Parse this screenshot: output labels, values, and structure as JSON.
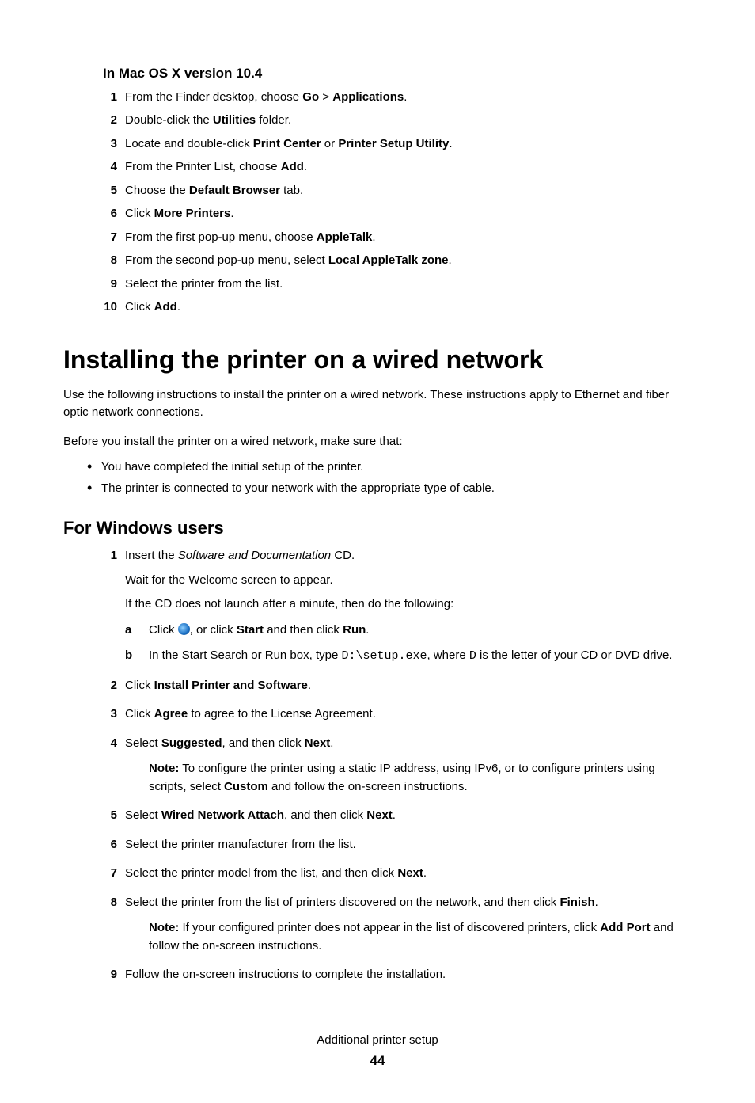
{
  "section_mac": {
    "heading": "In Mac OS X version 10.4",
    "steps": [
      {
        "n": "1",
        "parts": [
          "From the Finder desktop, choose ",
          {
            "b": "Go"
          },
          " > ",
          {
            "b": "Applications"
          },
          "."
        ]
      },
      {
        "n": "2",
        "parts": [
          "Double-click the ",
          {
            "b": "Utilities"
          },
          " folder."
        ]
      },
      {
        "n": "3",
        "parts": [
          "Locate and double-click ",
          {
            "b": "Print Center"
          },
          " or ",
          {
            "b": "Printer Setup Utility"
          },
          "."
        ]
      },
      {
        "n": "4",
        "parts": [
          "From the Printer List, choose ",
          {
            "b": "Add"
          },
          "."
        ]
      },
      {
        "n": "5",
        "parts": [
          "Choose the ",
          {
            "b": "Default Browser"
          },
          " tab."
        ]
      },
      {
        "n": "6",
        "parts": [
          "Click ",
          {
            "b": "More Printers"
          },
          "."
        ]
      },
      {
        "n": "7",
        "parts": [
          "From the first pop-up menu, choose ",
          {
            "b": "AppleTalk"
          },
          "."
        ]
      },
      {
        "n": "8",
        "parts": [
          "From the second pop-up menu, select ",
          {
            "b": "Local AppleTalk zone"
          },
          "."
        ]
      },
      {
        "n": "9",
        "parts": [
          "Select the printer from the list."
        ]
      },
      {
        "n": "10",
        "parts": [
          "Click ",
          {
            "b": "Add"
          },
          "."
        ]
      }
    ]
  },
  "section_install": {
    "heading": "Installing the printer on a wired network",
    "intro1": "Use the following instructions to install the printer on a wired network. These instructions apply to Ethernet and fiber optic network connections.",
    "intro2": "Before you install the printer on a wired network, make sure that:",
    "bullets": [
      "You have completed the initial setup of the printer.",
      "The printer is connected to your network with the appropriate type of cable."
    ]
  },
  "section_windows": {
    "heading": "For Windows users",
    "steps": [
      {
        "n": "1",
        "parts": [
          "Insert the ",
          {
            "i": "Software and Documentation"
          },
          " CD."
        ],
        "sub_paras": [
          "Wait for the Welcome screen to appear.",
          "If the CD does not launch after a minute, then do the following:"
        ],
        "alpha": [
          {
            "n": "a",
            "parts": [
              "Click ",
              {
                "icon": true
              },
              ", or click ",
              {
                "b": "Start"
              },
              " and then click ",
              {
                "b": "Run"
              },
              "."
            ]
          },
          {
            "n": "b",
            "parts": [
              "In the Start Search or Run box, type ",
              {
                "mono": "D:\\setup.exe"
              },
              ", where ",
              {
                "mono": "D"
              },
              " is the letter of your CD or DVD drive."
            ]
          }
        ]
      },
      {
        "n": "2",
        "parts": [
          "Click ",
          {
            "b": "Install Printer and Software"
          },
          "."
        ]
      },
      {
        "n": "3",
        "parts": [
          "Click ",
          {
            "b": "Agree"
          },
          " to agree to the License Agreement."
        ]
      },
      {
        "n": "4",
        "parts": [
          "Select ",
          {
            "b": "Suggested"
          },
          ", and then click ",
          {
            "b": "Next"
          },
          "."
        ],
        "note": [
          {
            "b": "Note:"
          },
          " To configure the printer using a static IP address, using IPv6, or to configure printers using scripts, select ",
          {
            "b": "Custom"
          },
          " and follow the on-screen instructions."
        ]
      },
      {
        "n": "5",
        "parts": [
          "Select ",
          {
            "b": "Wired Network Attach"
          },
          ", and then click ",
          {
            "b": "Next"
          },
          "."
        ]
      },
      {
        "n": "6",
        "parts": [
          "Select the printer manufacturer from the list."
        ]
      },
      {
        "n": "7",
        "parts": [
          "Select the printer model from the list, and then click ",
          {
            "b": "Next"
          },
          "."
        ]
      },
      {
        "n": "8",
        "parts": [
          "Select the printer from the list of printers discovered on the network, and then click ",
          {
            "b": "Finish"
          },
          "."
        ],
        "note": [
          {
            "b": "Note:"
          },
          " If your configured printer does not appear in the list of discovered printers, click ",
          {
            "b": "Add Port"
          },
          " and follow the on-screen instructions."
        ]
      },
      {
        "n": "9",
        "parts": [
          "Follow the on-screen instructions to complete the installation."
        ]
      }
    ]
  },
  "footer": {
    "title": "Additional printer setup",
    "page": "44"
  }
}
